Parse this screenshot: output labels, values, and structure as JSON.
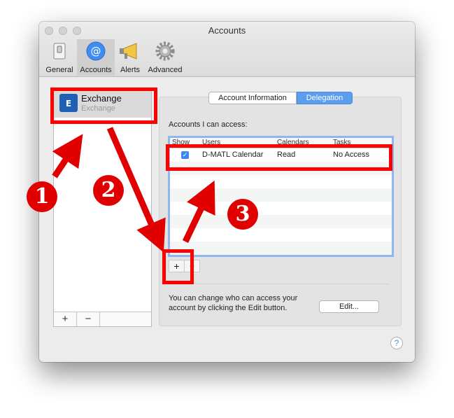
{
  "window": {
    "title": "Accounts"
  },
  "toolbar": {
    "items": [
      {
        "label": "General",
        "icon": "switch-icon"
      },
      {
        "label": "Accounts",
        "icon": "at-icon"
      },
      {
        "label": "Alerts",
        "icon": "megaphone-icon"
      },
      {
        "label": "Advanced",
        "icon": "gear-icon"
      }
    ],
    "selected": "Accounts"
  },
  "sidebar": {
    "account": {
      "name": "Exchange",
      "type": "Exchange",
      "icon": "exchange-icon"
    },
    "add_label": "+",
    "remove_label": "−"
  },
  "tabs": {
    "account_info": "Account Information",
    "delegation": "Delegation",
    "selected": "Delegation"
  },
  "access": {
    "label": "Accounts I can access:",
    "columns": [
      "Show",
      "Users",
      "Calendars",
      "Tasks"
    ],
    "rows": [
      {
        "show": true,
        "user": "D-MATL Calendar",
        "calendars": "Read",
        "tasks": "No Access"
      }
    ],
    "add_label": "+",
    "remove_label": "−"
  },
  "footer": {
    "help_text": "You can change who can access your account by clicking the Edit button.",
    "edit_label": "Edit...",
    "help_label": "?"
  },
  "annotations": {
    "step1": "1",
    "step2": "2",
    "step3": "3"
  },
  "colors": {
    "accent": "#5c9ded",
    "highlight": "#ff0000"
  }
}
